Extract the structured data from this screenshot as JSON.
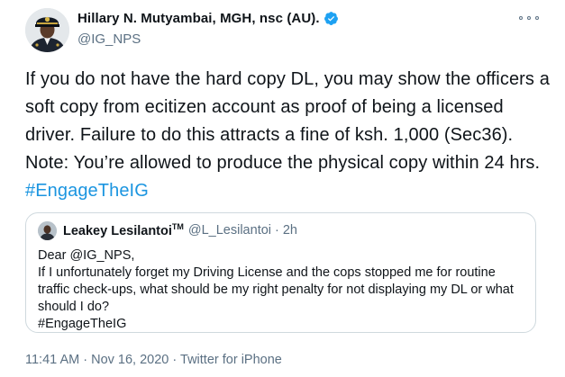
{
  "author": {
    "display_name": "Hillary N. Mutyambai, MGH, nsc (AU).",
    "handle": "@IG_NPS",
    "verified_icon": "verified-badge-icon",
    "accent_color": "#1da1f2"
  },
  "tweet": {
    "text": "If you do not have the hard copy DL, you may show the officers a soft copy from ecitizen account as proof of being a licensed driver. Failure to do this attracts a fine of ksh. 1,000 (Sec36). Note: You’re allowed to produce the physical copy within 24 hrs.",
    "hashtag": "#EngageTheIG",
    "hashtag_color": "#1b95e0"
  },
  "quoted": {
    "display_name": "Leakey Lesilantoi",
    "name_mark": "TM",
    "handle": "@L_Lesilantoi",
    "separator": "·",
    "time": "2h",
    "lines": [
      "Dear @IG_NPS,",
      "If I unfortunately forget my Driving License and the cops stopped me for routine traffic check-ups, what should be my right penalty for not displaying my DL or what should I do?",
      "#EngageTheIG"
    ]
  },
  "meta": {
    "time": "11:41 AM",
    "separator1": "·",
    "date": "Nov 16, 2020",
    "separator2": "·",
    "source": "Twitter for iPhone"
  },
  "more_icon": "more-horizontal-icon"
}
